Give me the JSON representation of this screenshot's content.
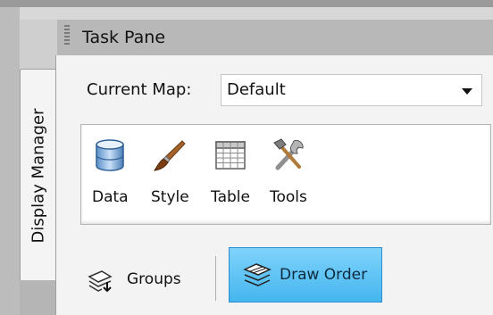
{
  "title_bar": {
    "title": "Task Pane"
  },
  "side_tab": {
    "label": "Display Manager"
  },
  "current_map": {
    "label": "Current Map:",
    "value": "Default"
  },
  "ribbon": {
    "tools": [
      {
        "label": "Data",
        "icon": "database-icon"
      },
      {
        "label": "Style",
        "icon": "paintbrush-icon"
      },
      {
        "label": "Table",
        "icon": "table-icon"
      },
      {
        "label": "Tools",
        "icon": "wrench-hammer-icon"
      }
    ]
  },
  "view_toggle": {
    "groups_label": "Groups",
    "draw_order_label": "Draw Order",
    "selected": "Draw Order"
  },
  "colors": {
    "selected_button": "#45b6ee",
    "selected_border": "#2a8ed0",
    "title_bar": "#b8b8b8"
  }
}
